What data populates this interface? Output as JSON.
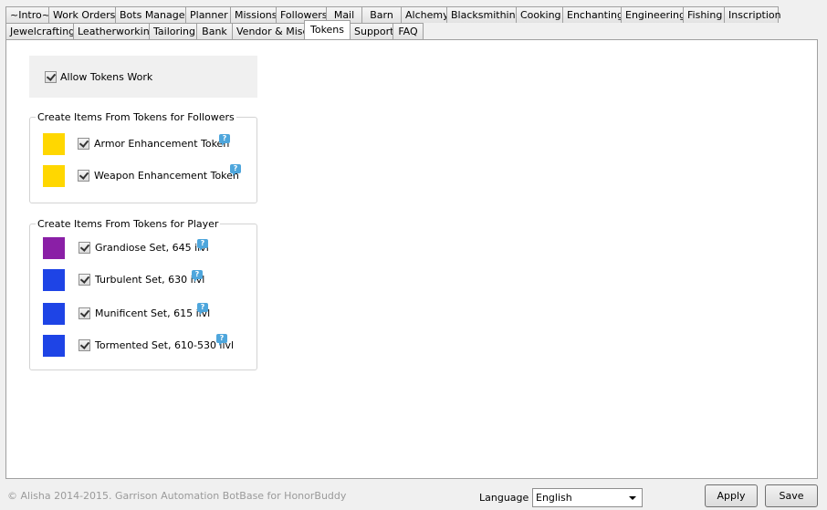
{
  "tabs_row1": [
    "~Intro~",
    "Work Orders",
    "Bots Manager",
    "Planner",
    "Missions",
    "Followers",
    "Mail",
    "Barn",
    "Alchemy",
    "Blacksmithing",
    "Cooking",
    "Enchanting",
    "Engineering",
    "Fishing",
    "Inscription"
  ],
  "tabs_row2": [
    "Jewelcrafting",
    "Leatherworking",
    "Tailoring",
    "Bank",
    "Vendor & Misc",
    "Tokens",
    "Support",
    "FAQ"
  ],
  "active_tab": "Tokens",
  "allow": {
    "label": "Allow Tokens Work",
    "checked": true
  },
  "followers_group": {
    "title": "Create Items From Tokens for Followers",
    "items": [
      {
        "label": "Armor Enhancement Token",
        "color": "#ffd700",
        "checked": true,
        "help": "?"
      },
      {
        "label": "Weapon Enhancement Token",
        "color": "#ffd700",
        "checked": true,
        "help": "?"
      }
    ]
  },
  "player_group": {
    "title": "Create Items From Tokens for Player",
    "items": [
      {
        "label": "Grandiose Set, 645 ilvl",
        "color": "#8a1fa6",
        "checked": true,
        "help": "?"
      },
      {
        "label": "Turbulent Set, 630 ilvl",
        "color": "#1e44e6",
        "checked": true,
        "help": "?"
      },
      {
        "label": "Munificent Set, 615 ilvl",
        "color": "#1e44e6",
        "checked": true,
        "help": "?"
      },
      {
        "label": "Tormented Set, 610-530 ilvl",
        "color": "#1e44e6",
        "checked": true,
        "help": "?"
      }
    ]
  },
  "footer": {
    "copyright": "© Alisha 2014-2015. Garrison Automation BotBase for HonorBuddy",
    "language_label": "Language",
    "language_value": "English",
    "apply_label": "Apply",
    "save_label": "Save"
  }
}
